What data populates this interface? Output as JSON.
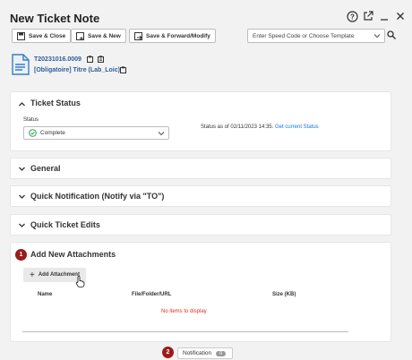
{
  "window": {
    "title": "New Ticket Note"
  },
  "toolbar": {
    "save_close": "Save & Close",
    "save_new": "Save & New",
    "save_forward": "Save & Forward/Modify",
    "speed_code_placeholder": "Enter Speed Code or Choose Template"
  },
  "ticket": {
    "number": "T20231016.0009",
    "subtitle": "[Obligatoire] Titre (Lab_Loic)"
  },
  "sections": {
    "ticket_status": "Ticket Status",
    "general": "General",
    "quick_notification": "Quick Notification (Notify via \"TO\")",
    "quick_edits": "Quick Ticket Edits",
    "attachments": "Add New Attachments"
  },
  "status": {
    "label": "Status",
    "value": "Complete",
    "as_of": "Status as of 02/11/2023 14:35.",
    "get_current": "Get current Status"
  },
  "attachments": {
    "add_button": "Add Attachment",
    "columns": [
      "Name",
      "File/Folder/URL",
      "Size (KB)"
    ],
    "empty": "No items to display"
  },
  "footer": {
    "notification_label": "Notification",
    "notification_count": "0"
  },
  "markers": [
    "1",
    "2"
  ],
  "colors": {
    "accent": "#1a73e8",
    "marker": "#9b1c1c",
    "error": "#d93025",
    "status_ok": "#2e9d4a"
  }
}
